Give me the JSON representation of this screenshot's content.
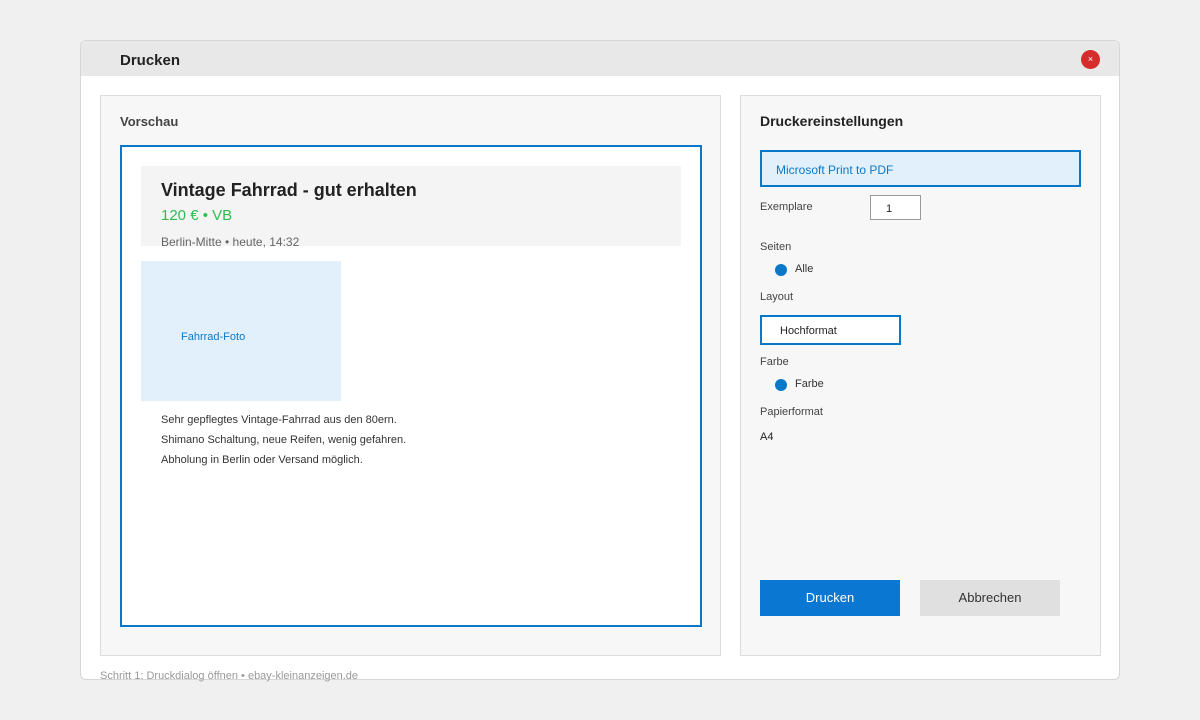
{
  "dialog": {
    "title": "Drucken",
    "close_glyph": "×"
  },
  "preview": {
    "title": "Vorschau",
    "ad": {
      "title": "Vintage Fahrrad - gut erhalten",
      "price": "120 € • VB",
      "meta": "Berlin-Mitte • heute, 14:32",
      "photo_label": "Fahrrad-Foto",
      "description": [
        "Sehr gepflegtes Vintage-Fahrrad aus den 80ern.",
        "Shimano Schaltung, neue Reifen, wenig gefahren.",
        "Abholung in Berlin oder Versand möglich."
      ]
    }
  },
  "settings": {
    "title": "Druckereinstellungen",
    "printer": "Microsoft Print to PDF",
    "copies_label": "Exemplare",
    "copies_value": "1",
    "pages_label": "Seiten",
    "pages_option": "Alle",
    "layout_label": "Layout",
    "layout_value": "Hochformat",
    "color_label": "Farbe",
    "color_option": "Farbe",
    "paper_label": "Papierformat",
    "paper_value": "A4",
    "print_button": "Drucken",
    "cancel_button": "Abbrechen"
  },
  "footer": "Schritt 1: Druckdialog öffnen • ebay-kleinanzeigen.de",
  "colors": {
    "accent": "#0a78c8",
    "price": "#2dbd4e",
    "close": "#d62c2c"
  }
}
